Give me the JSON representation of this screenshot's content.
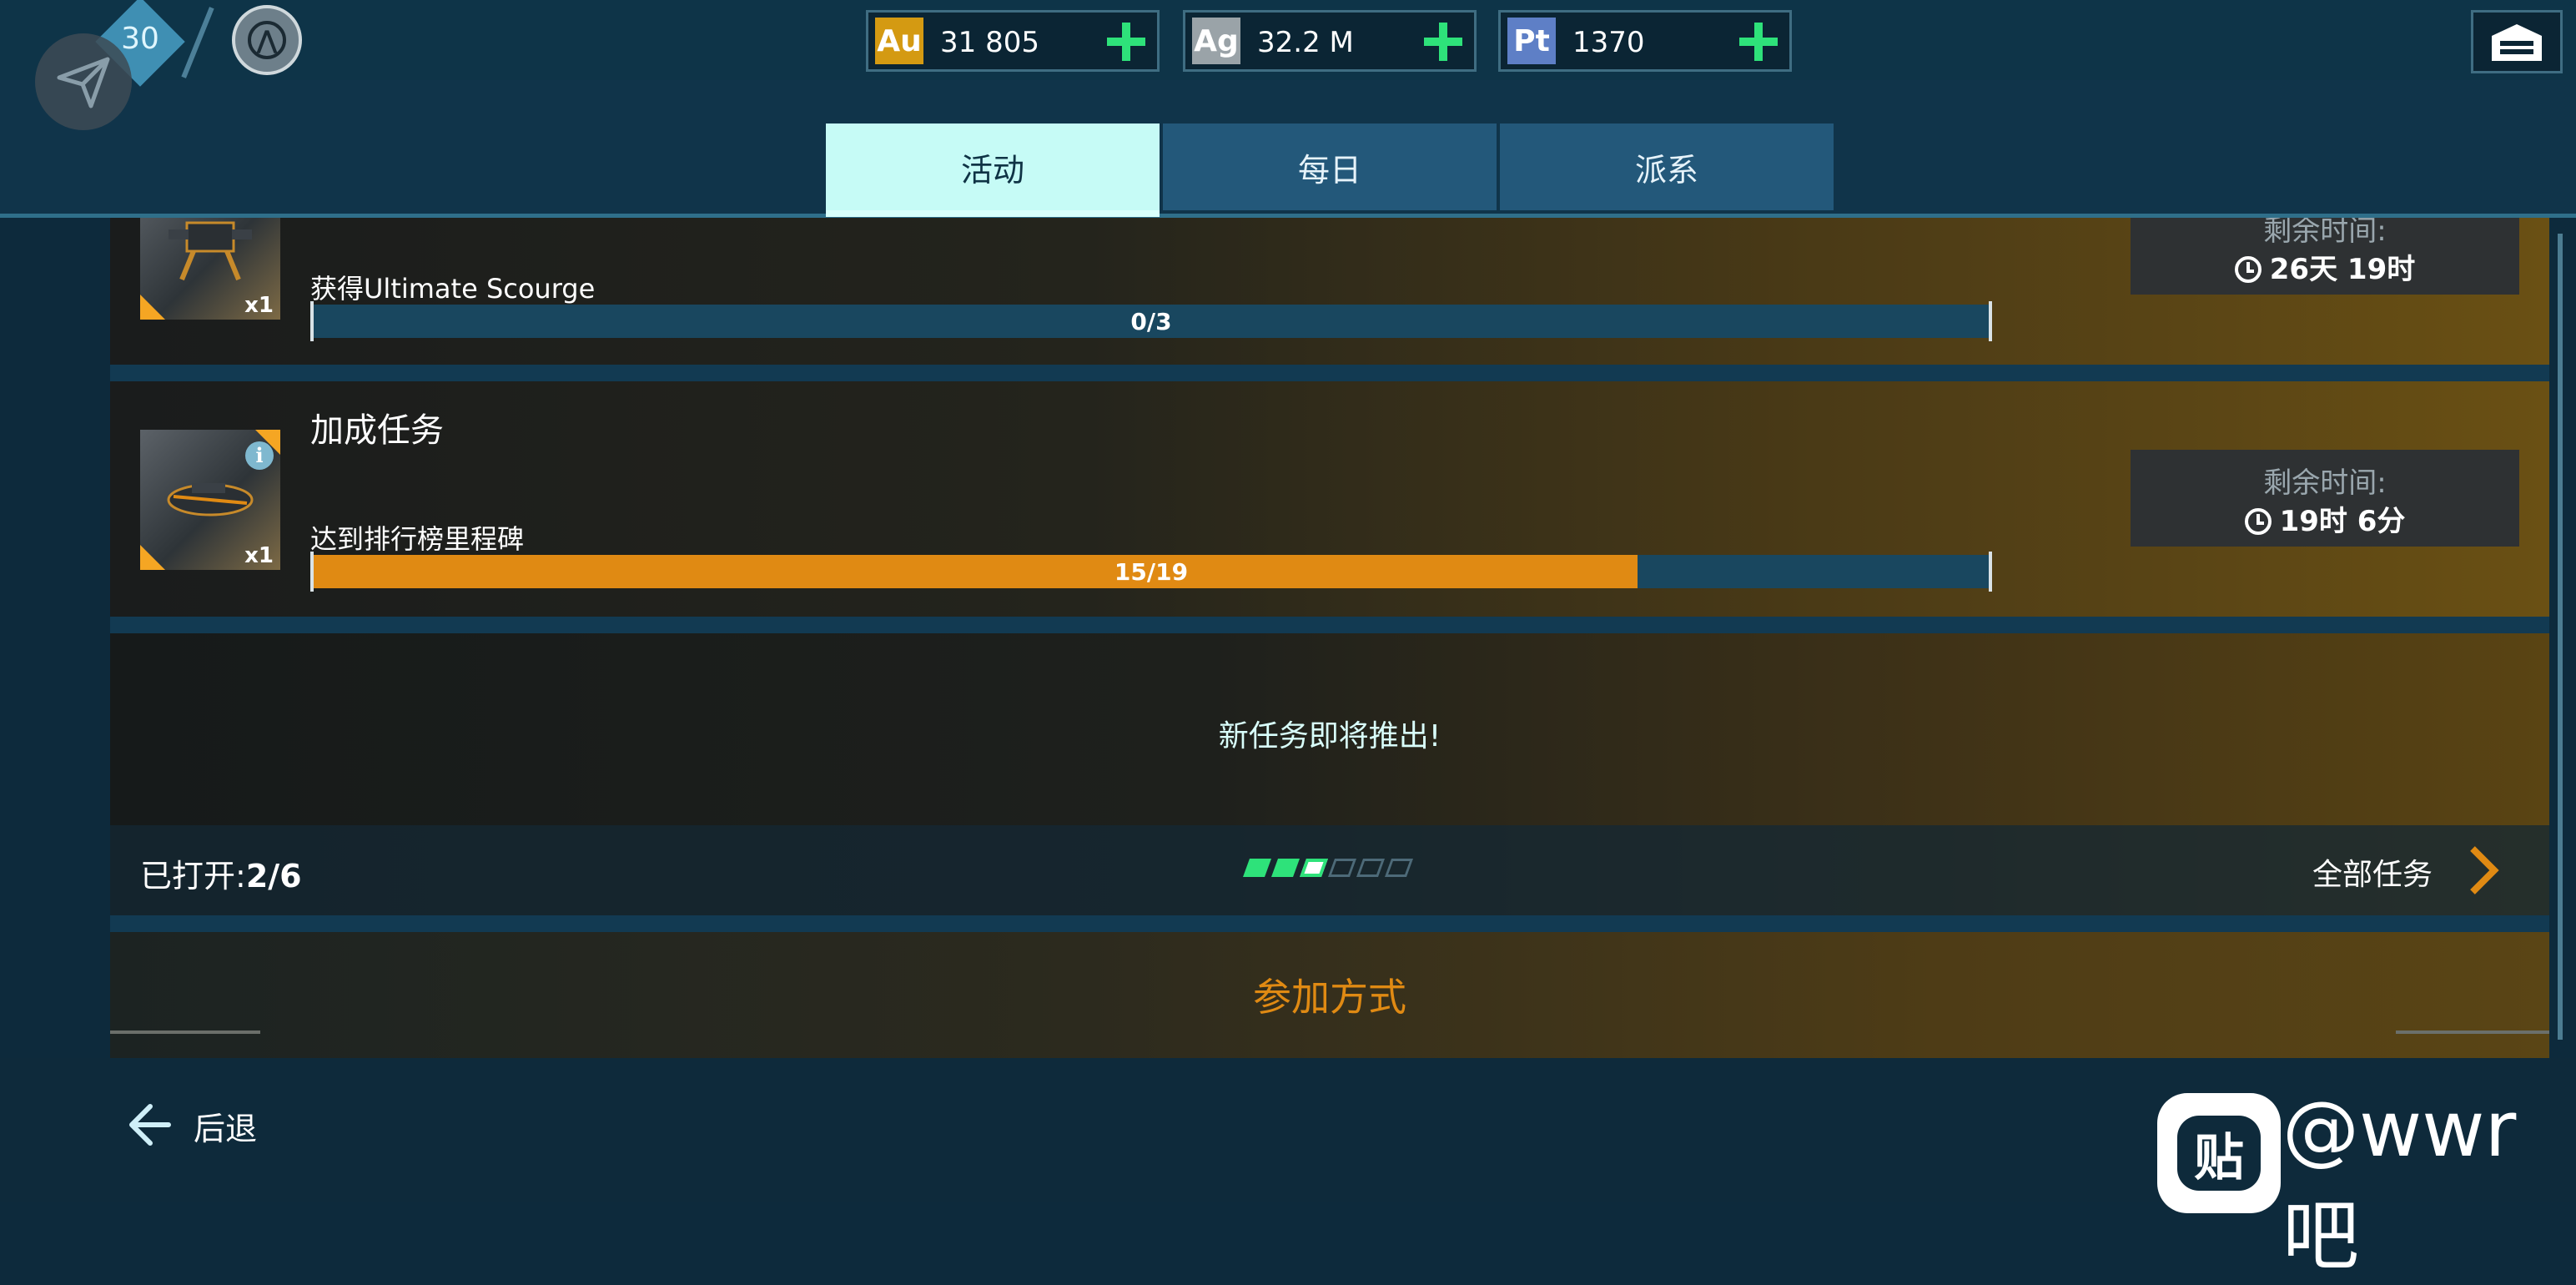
{
  "header": {
    "level": "30",
    "currencies": [
      {
        "code": "Au",
        "value": "31 805",
        "color": "#d49a12"
      },
      {
        "code": "Ag",
        "value": "32.2 M",
        "color": "#9aa3a8"
      },
      {
        "code": "Pt",
        "value": "1370",
        "color": "#5e7fc6"
      }
    ]
  },
  "tabs": [
    {
      "label": "活动",
      "active": true
    },
    {
      "label": "每日",
      "active": false
    },
    {
      "label": "派系",
      "active": false
    }
  ],
  "tasks": [
    {
      "title": "",
      "description": "获得Ultimate Scourge",
      "progress_text": "0/3",
      "progress": 0.0,
      "quantity": "x1",
      "timer_label": "剩余时间:",
      "timer_value": "26天 19时"
    },
    {
      "title": "加成任务",
      "description": "达到排行榜里程碑",
      "progress_text": "15/19",
      "progress": 0.789,
      "quantity": "x1",
      "timer_label": "剩余时间:",
      "timer_value": "19时 6分"
    }
  ],
  "coming_soon": "新任务即将推出!",
  "status": {
    "opened_label": "已打开:",
    "opened_value": "2/6",
    "page_dots_total": 6,
    "page_dots_filled": 2,
    "page_dots_current": 3,
    "all_tasks_label": "全部任务"
  },
  "how_to_join": "参加方式",
  "footer": {
    "back_label": "后退",
    "watermark": "@wwr吧",
    "tieba_glyph": "贴"
  },
  "colors": {
    "accent_green": "#2ee27a",
    "progress_orange": "#e08a13",
    "tab_active": "#c6fbf6",
    "join_orange": "#e08a13"
  }
}
